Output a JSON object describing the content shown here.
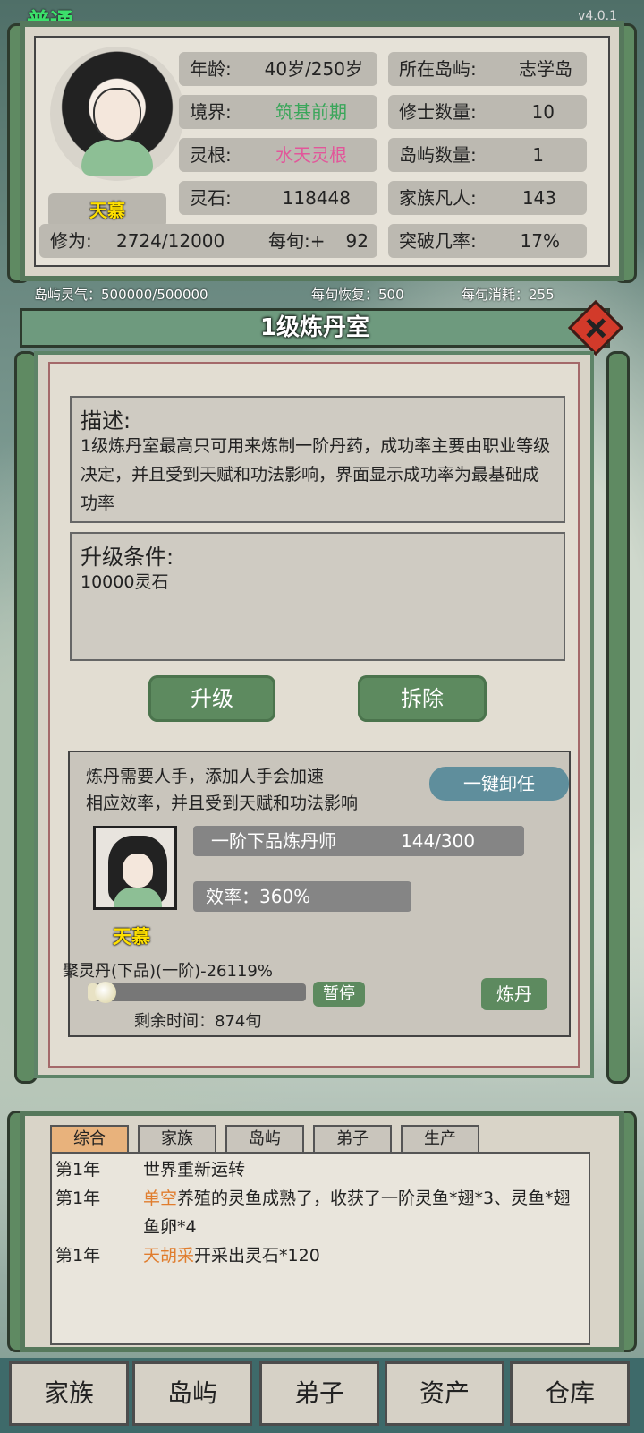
{
  "app": {
    "corner_label": "普通",
    "version": "v4.0.1"
  },
  "player": {
    "name": "天慕",
    "age_label": "年龄:",
    "age_value": "40岁/250岁",
    "realm_label": "境界:",
    "realm_value": "筑基前期",
    "root_label": "灵根:",
    "root_value": "水天灵根",
    "stones_label": "灵石:",
    "stones_value": "118448",
    "cultivation_label": "修为:",
    "cultivation_value": "2724/12000",
    "per_turn_label": "每旬:+",
    "per_turn_value": "92",
    "island_label": "所在岛屿:",
    "island_value": "志学岛",
    "cultivators_label": "修士数量:",
    "cultivators_value": "10",
    "islands_label": "岛屿数量:",
    "islands_value": "1",
    "mortals_label": "家族凡人:",
    "mortals_value": "143",
    "breakthrough_label": "突破几率:",
    "breakthrough_value": "17%"
  },
  "aura": {
    "island_aura": "岛屿灵气：500000/500000",
    "recover": "每旬恢复：500",
    "consume": "每旬消耗：255"
  },
  "dialog": {
    "title": "1级炼丹室",
    "desc_title": "描述:",
    "desc_text": "1级炼丹室最高只可用来炼制一阶丹药，成功率主要由职业等级决定，并且受到天赋和功法影响，界面显示成功率为最基础成功率",
    "upgrade_title": "升级条件:",
    "upgrade_text": "10000灵石",
    "upgrade_btn": "升级",
    "demolish_btn": "拆除",
    "worker_info_line1": "炼丹需要人手，添加人手会加速",
    "worker_info_line2": "相应效率，并且受到天赋和功法影响",
    "dismiss_all_btn": "一键卸任",
    "worker_rank": "一阶下品炼丹师",
    "worker_exp": "144/300",
    "worker_efficiency": "效率：360%",
    "worker_name": "天慕",
    "task_label": "聚灵丹(下品)(一阶)-26119%",
    "task_progress": 0.05,
    "pause_btn": "暂停",
    "refine_btn": "炼丹",
    "remaining_time": "剩余时间：874旬"
  },
  "log": {
    "tabs": [
      "综合",
      "家族",
      "岛屿",
      "弟子",
      "生产"
    ],
    "active_tab": 0,
    "entries": [
      {
        "year": "第1年",
        "actor": "",
        "text": "世界重新运转"
      },
      {
        "year": "第1年",
        "actor": "单空",
        "text": "养殖的灵鱼成熟了，收获了一阶灵鱼*翅*3、灵鱼*翅鱼卵*4"
      },
      {
        "year": "第1年",
        "actor": "天胡采",
        "text": "开采出灵石*120"
      }
    ]
  },
  "nav": {
    "items": [
      "家族",
      "岛屿",
      "弟子",
      "资产",
      "仓库"
    ]
  },
  "colors": {
    "accent_green": "#5d8a5f",
    "realm": "#3aa65a",
    "root": "#e2569a",
    "actor": "#e07d2e",
    "name": "#ffe000"
  }
}
